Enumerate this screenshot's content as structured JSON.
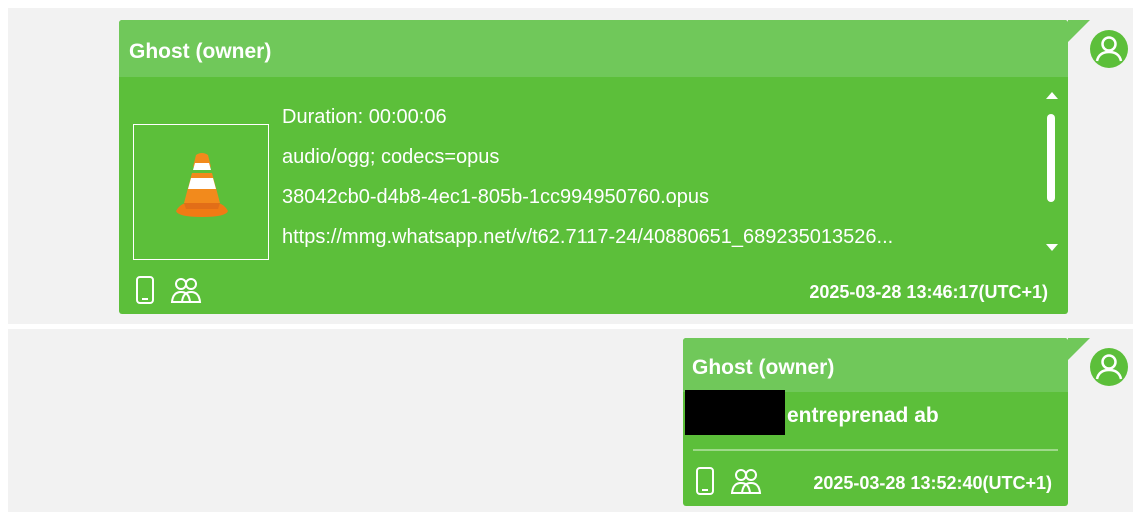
{
  "messages": [
    {
      "sender": "Ghost (owner)",
      "attachment": {
        "icon": "vlc-media-icon",
        "duration": "Duration: 00:00:06",
        "mime": "audio/ogg; codecs=opus",
        "filename": "38042cb0-d4b8-4ec1-805b-1cc994950760.opus",
        "url": "https://mmg.whatsapp.net/v/t62.7117-24/40880651_689235013526..."
      },
      "timestamp": "2025-03-28 13:46:17(UTC+1)",
      "footer_icons": [
        "phone-icon",
        "group-icon"
      ]
    },
    {
      "sender": "Ghost (owner)",
      "text": "entreprenad ab",
      "timestamp": "2025-03-28 13:52:40(UTC+1)",
      "footer_icons": [
        "phone-icon",
        "group-icon"
      ]
    }
  ],
  "colors": {
    "bubble": "#5cbf3a",
    "bubble_header": "#70c85a",
    "avatar": "#5cbf3a",
    "row_background": "#f2f2f2"
  }
}
